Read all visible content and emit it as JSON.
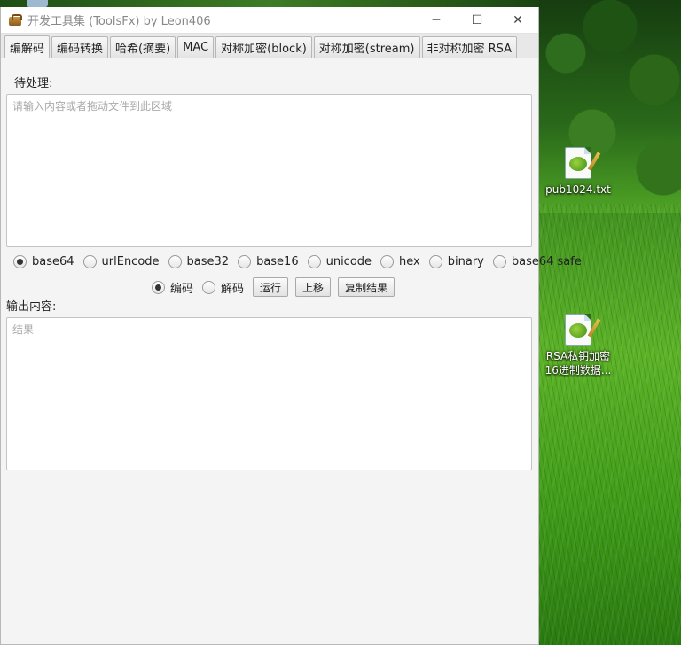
{
  "window": {
    "title": "开发工具集 (ToolsFx) by Leon406",
    "controls": {
      "minimize": "─",
      "maximize": "☐",
      "close": "✕"
    }
  },
  "tabs": [
    {
      "label": "编解码",
      "active": true
    },
    {
      "label": "编码转换",
      "active": false
    },
    {
      "label": "哈希(摘要)",
      "active": false
    },
    {
      "label": "MAC",
      "active": false
    },
    {
      "label": "对称加密(block)",
      "active": false
    },
    {
      "label": "对称加密(stream)",
      "active": false
    },
    {
      "label": "非对称加密 RSA",
      "active": false
    }
  ],
  "input": {
    "label": "待处理:",
    "placeholder": "请输入内容或者拖动文件到此区域"
  },
  "encodings": [
    {
      "label": "base64",
      "selected": true
    },
    {
      "label": "urlEncode",
      "selected": false
    },
    {
      "label": "base32",
      "selected": false
    },
    {
      "label": "base16",
      "selected": false
    },
    {
      "label": "unicode",
      "selected": false
    },
    {
      "label": "hex",
      "selected": false
    },
    {
      "label": "binary",
      "selected": false
    },
    {
      "label": "base64 safe",
      "selected": false
    }
  ],
  "mode": [
    {
      "label": "编码",
      "selected": true
    },
    {
      "label": "解码",
      "selected": false
    }
  ],
  "actions": {
    "run": "运行",
    "move_up": "上移",
    "copy_result": "复制结果"
  },
  "output": {
    "label": "输出内容:",
    "placeholder": "结果"
  },
  "desktop": {
    "icons": [
      {
        "label": "pub1024.txt"
      },
      {
        "label": "RSA私钥加密16进制数据..."
      }
    ]
  }
}
